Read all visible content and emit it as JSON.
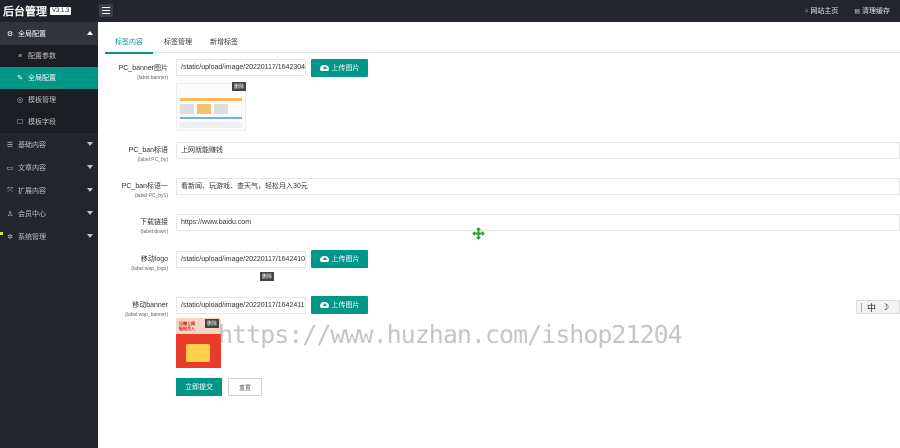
{
  "header": {
    "app_title": "后台管理",
    "version": "V3.1.3",
    "links": [
      {
        "label": "网站主页",
        "icon": "home-icon"
      },
      {
        "label": "清理缓存",
        "icon": "trash-icon"
      }
    ]
  },
  "sidebar": {
    "groups": [
      {
        "label": "全局配置",
        "icon": "settings-icon",
        "open": true,
        "children": [
          {
            "label": "配置参数",
            "icon": "list-icon",
            "active": false
          },
          {
            "label": "全局配置",
            "icon": "wrench-icon",
            "active": true
          },
          {
            "label": "模板管理",
            "icon": "target-icon",
            "active": false
          },
          {
            "label": "模板字段",
            "icon": "edit-icon",
            "active": false
          }
        ]
      },
      {
        "label": "基础内容",
        "icon": "list-icon"
      },
      {
        "label": "文章内容",
        "icon": "document-icon"
      },
      {
        "label": "扩展内容",
        "icon": "expand-icon"
      },
      {
        "label": "会员中心",
        "icon": "user-icon"
      },
      {
        "label": "系统管理",
        "icon": "gear-icon"
      }
    ]
  },
  "tabs": [
    {
      "label": "标签内容",
      "active": true
    },
    {
      "label": "标签管理",
      "active": false
    },
    {
      "label": "新增标签",
      "active": false
    }
  ],
  "form": {
    "pc_banner": {
      "label": "PC_banner图片",
      "sub": "{label:banner}",
      "value": "/static/upload/image/20220117/1642304",
      "button": "上传图片"
    },
    "pc_ban_title": {
      "label": "PC_ban标语",
      "sub": "{label:PC_by}",
      "value": "上网就能赚钱"
    },
    "pc_ban_title1": {
      "label": "PC_ban标语一",
      "sub": "{label:PC_by1}",
      "value": "看新闻、玩游戏、查天气，轻松月入30元"
    },
    "download": {
      "label": "下载链接",
      "sub": "{label:down}",
      "value": "https://www.baidu.com"
    },
    "wap_logo": {
      "label": "移动logo",
      "sub": "{label:wap_logo}",
      "value": "/static/upload/image/20220117/1642410",
      "button": "上传图片"
    },
    "wap_banner": {
      "label": "移动banner",
      "sub": "{label:wap_banner}",
      "value": "/static/upload/image/20220117/1642411",
      "button": "上传图片"
    },
    "delete_label": "删除",
    "banner_preview_text": "日赚上网\n轻松月入",
    "submit_label": "立即提交",
    "reset_label": "重置"
  },
  "watermark": "https://www.huzhan.com/ishop21204",
  "ime": {
    "lang": "中",
    "mode": "☽"
  },
  "colors": {
    "accent": "#009688",
    "sidebar_bg": "#23262e",
    "header_bg": "#23262e"
  }
}
